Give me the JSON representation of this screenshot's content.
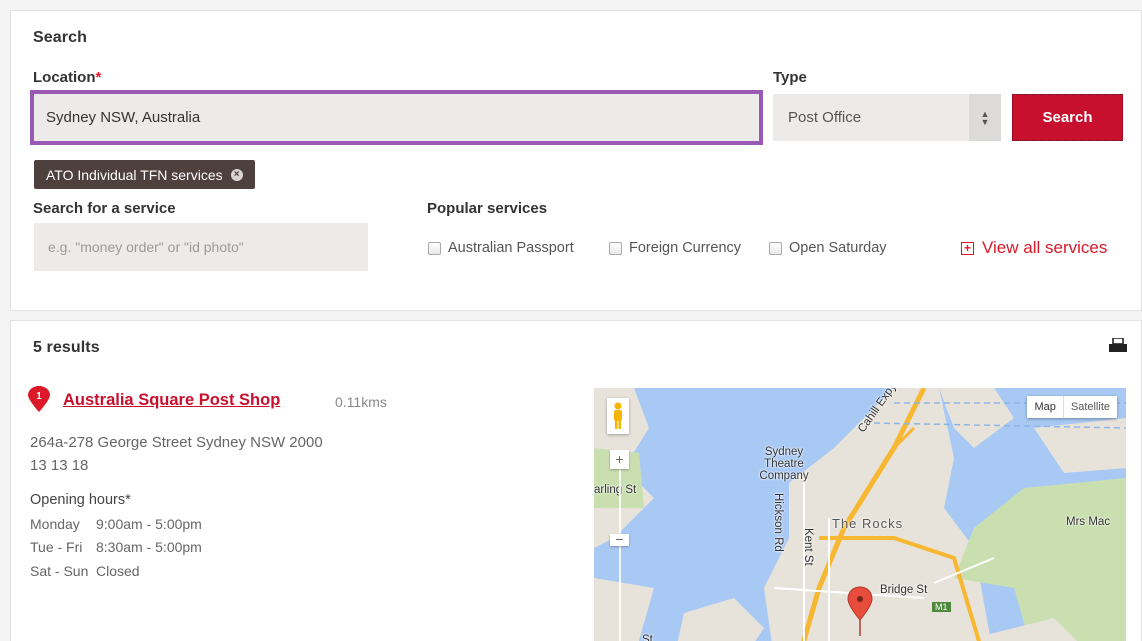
{
  "search": {
    "heading": "Search",
    "location_label": "Location",
    "required_marker": "*",
    "location_value": "Sydney NSW, Australia",
    "type_label": "Type",
    "type_selected": "Post Office",
    "search_button": "Search",
    "active_filter": "ATO Individual TFN services",
    "service_label": "Search for a service",
    "service_placeholder": "e.g. \"money order\" or \"id photo\"",
    "popular_label": "Popular services",
    "popular": [
      {
        "label": "Australian Passport",
        "checked": false
      },
      {
        "label": "Foreign Currency",
        "checked": false
      },
      {
        "label": "Open Saturday",
        "checked": false
      }
    ],
    "view_all": "View all services"
  },
  "results": {
    "count_label": "5 results",
    "first": {
      "index": "1",
      "name": "Australia Square Post Shop",
      "distance": "0.11kms",
      "address": "264a-278 George Street  Sydney  NSW  2000",
      "phone": "13 13 18",
      "hours_title": "Opening hours*",
      "hours": [
        {
          "day": "Monday",
          "time": "9:00am - 5:00pm"
        },
        {
          "day": "Tue - Fri",
          "time": "8:30am - 5:00pm"
        },
        {
          "day": "Sat - Sun",
          "time": "Closed"
        }
      ]
    }
  },
  "map": {
    "type_map": "Map",
    "type_satellite": "Satellite",
    "zoom_in": "+",
    "zoom_out": "−",
    "labels": [
      "Sydney Theatre Company",
      "The Rocks",
      "Bridge St",
      "Mrs Mac",
      "Cahill Expy (Toll",
      "Hickson Rd",
      "Kent St",
      "arling St",
      "M1",
      "St"
    ]
  },
  "colors": {
    "brand_red": "#c8102e",
    "focus_purple": "#9b59b6",
    "tag_dark": "#4d403d"
  }
}
